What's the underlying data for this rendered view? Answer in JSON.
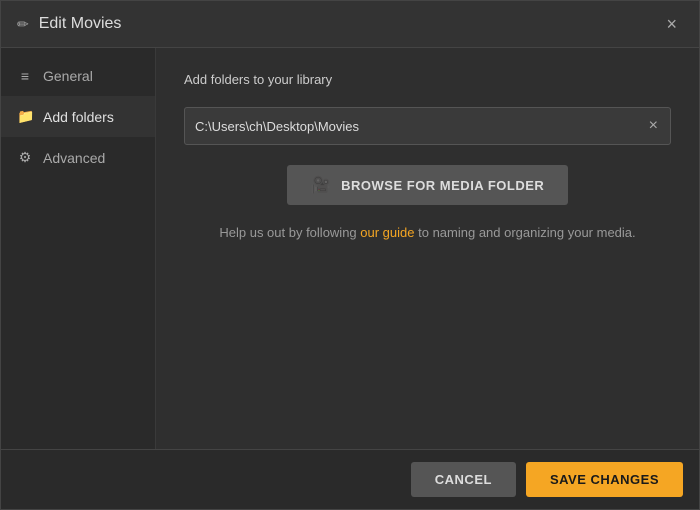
{
  "dialog": {
    "title": "Edit Movies",
    "close_label": "×"
  },
  "sidebar": {
    "items": [
      {
        "id": "general",
        "label": "General",
        "icon": "≡",
        "icon_type": "menu",
        "active": false
      },
      {
        "id": "add-folders",
        "label": "Add folders",
        "icon": "📁",
        "icon_type": "folder",
        "active": true
      },
      {
        "id": "advanced",
        "label": "Advanced",
        "icon": "⚙",
        "icon_type": "gear",
        "active": false
      }
    ]
  },
  "main": {
    "section_title": "Add folders to your library",
    "folder_path": "C:\\Users\\ch\\Desktop\\Movies",
    "browse_button_label": "BROWSE FOR MEDIA FOLDER",
    "help_text_prefix": "Help us out by following ",
    "help_link_text": "our guide",
    "help_text_suffix": " to naming and organizing your media."
  },
  "footer": {
    "cancel_label": "CANCEL",
    "save_label": "SAVE CHANGES"
  }
}
